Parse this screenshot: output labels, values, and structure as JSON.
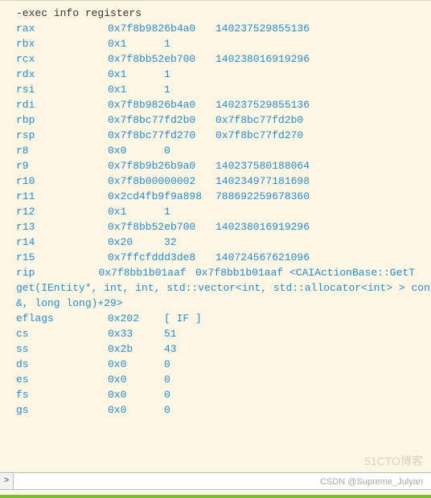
{
  "command": "-exec info registers",
  "registers": [
    {
      "name": "rax",
      "hex": "0x7f8b9826b4a0",
      "dec": "140237529855136",
      "wide": true
    },
    {
      "name": "rbx",
      "hex": "0x1",
      "dec": "1",
      "wide": false
    },
    {
      "name": "rcx",
      "hex": "0x7f8bb52eb700",
      "dec": "140238016919296",
      "wide": true
    },
    {
      "name": "rdx",
      "hex": "0x1",
      "dec": "1",
      "wide": false
    },
    {
      "name": "rsi",
      "hex": "0x1",
      "dec": "1",
      "wide": false
    },
    {
      "name": "rdi",
      "hex": "0x7f8b9826b4a0",
      "dec": "140237529855136",
      "wide": true
    },
    {
      "name": "rbp",
      "hex": "0x7f8bc77fd2b0",
      "dec": "0x7f8bc77fd2b0",
      "wide": true
    },
    {
      "name": "rsp",
      "hex": "0x7f8bc77fd270",
      "dec": "0x7f8bc77fd270",
      "wide": true
    },
    {
      "name": "r8",
      "hex": "0x0",
      "dec": "0",
      "wide": false
    },
    {
      "name": "r9",
      "hex": "0x7f8b9b26b9a0",
      "dec": "140237580188064",
      "wide": true
    },
    {
      "name": "r10",
      "hex": "0x7f8b00000002",
      "dec": "140234977181698",
      "wide": true
    },
    {
      "name": "r11",
      "hex": "0x2cd4fb9f9a898",
      "dec": "788692259678360",
      "wide": true
    },
    {
      "name": "r12",
      "hex": "0x1",
      "dec": "1",
      "wide": false
    },
    {
      "name": "r13",
      "hex": "0x7f8bb52eb700",
      "dec": "140238016919296",
      "wide": true
    },
    {
      "name": "r14",
      "hex": "0x20",
      "dec": "32",
      "wide": false
    },
    {
      "name": "r15",
      "hex": "0x7ffcfddd3de8",
      "dec": "140724567621096",
      "wide": true
    },
    {
      "name": "rip",
      "hex": "0x7f8bb1b01aaf",
      "dec": "0x7f8bb1b01aaf <CAIActionBase::GetT",
      "wide": true
    }
  ],
  "continuation": [
    "get(IEntity*, int, int, std::vector<int, std::allocator<int> > cons",
    "&, long long)+29>"
  ],
  "registers_tail": [
    {
      "name": "eflags",
      "hex": "0x202",
      "dec": "[ IF ]",
      "wide": false
    },
    {
      "name": "cs",
      "hex": "0x33",
      "dec": "51",
      "wide": false
    },
    {
      "name": "ss",
      "hex": "0x2b",
      "dec": "43",
      "wide": false
    },
    {
      "name": "ds",
      "hex": "0x0",
      "dec": "0",
      "wide": false
    },
    {
      "name": "es",
      "hex": "0x0",
      "dec": "0",
      "wide": false
    },
    {
      "name": "fs",
      "hex": "0x0",
      "dec": "0",
      "wide": false
    },
    {
      "name": "gs",
      "hex": "0x0",
      "dec": "0",
      "wide": false
    }
  ],
  "prompt": {
    "symbol": ">",
    "value": "",
    "placeholder": ""
  },
  "watermarks": {
    "top": "51CTO博客",
    "bottom": "CSDN @Supreme_Julyan"
  }
}
